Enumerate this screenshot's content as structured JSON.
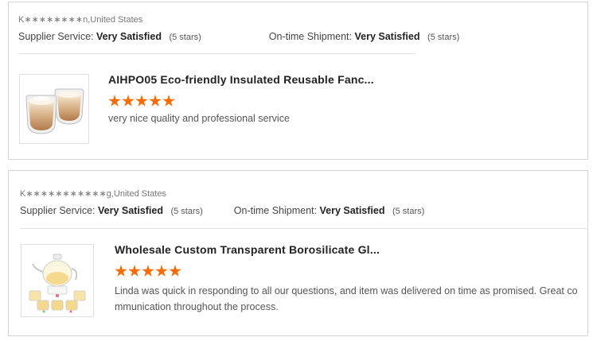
{
  "reviews": [
    {
      "buyer": "K∗∗∗∗∗∗∗∗n,United States",
      "supplier_label": "Supplier Service:",
      "supplier_value": "Very Satisfied",
      "supplier_stars": "(5 stars)",
      "shipment_label": "On-time Shipment:",
      "shipment_value": "Very Satisfied",
      "shipment_stars": "(5 stars)",
      "product_title": "AIHPO05 Eco-friendly Insulated Reusable Fanc...",
      "rating": 5,
      "comment": "very nice quality and professional service",
      "thumb_icon": "double-wall-glass-cups-icon"
    },
    {
      "buyer": "K∗∗∗∗∗∗∗∗∗∗∗g,United States",
      "supplier_label": "Supplier Service:",
      "supplier_value": "Very Satisfied",
      "supplier_stars": "(5 stars)",
      "shipment_label": "On-time Shipment:",
      "shipment_value": "Very Satisfied",
      "shipment_stars": "(5 stars)",
      "product_title": "Wholesale Custom Transparent Borosilicate Gl...",
      "rating": 5,
      "comment": "Linda was quick in responding to all our questions, and item was delivered on time as promised.  Great co mmunication throughout the process.",
      "thumb_icon": "glass-teapot-set-icon"
    }
  ],
  "colors": {
    "star": "#ff6a00",
    "border": "#d6d6d6"
  }
}
